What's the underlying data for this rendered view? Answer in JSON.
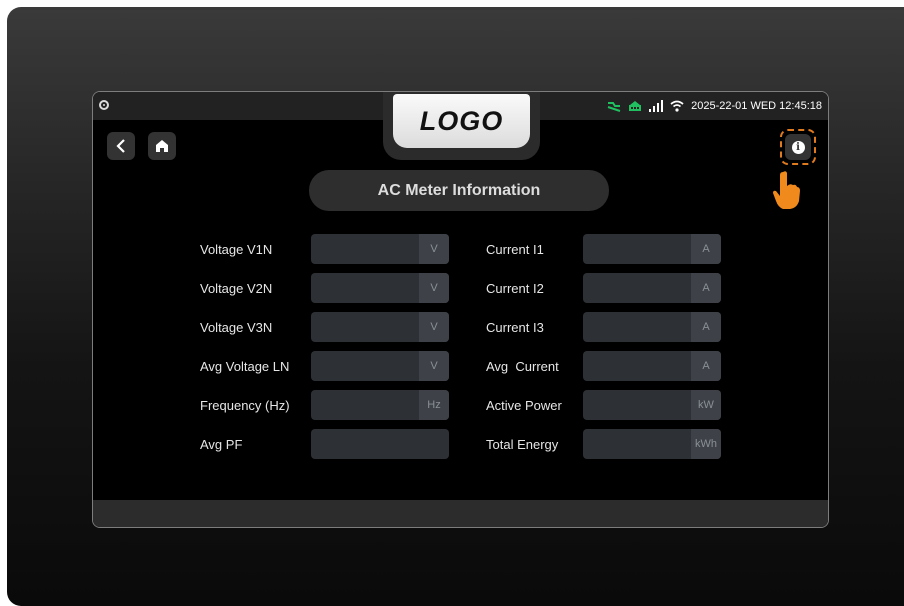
{
  "logo": "LOGO",
  "status": {
    "datetime": "2025-22-01 WED 12:45:18",
    "icons": [
      "charger-icon",
      "network-icon",
      "signal-bars-icon",
      "wifi-icon"
    ]
  },
  "page_title": "AC Meter Information",
  "left_fields": [
    {
      "label": "Voltage V1N",
      "unit": "V"
    },
    {
      "label": "Voltage V2N",
      "unit": "V"
    },
    {
      "label": "Voltage V3N",
      "unit": "V"
    },
    {
      "label": "Avg Voltage LN",
      "unit": "V"
    },
    {
      "label": "Frequency (Hz)",
      "unit": "Hz"
    },
    {
      "label": "Avg PF",
      "unit": ""
    }
  ],
  "right_fields": [
    {
      "label": "Current I1",
      "unit": "A"
    },
    {
      "label": "Current I2",
      "unit": "A"
    },
    {
      "label": "Current I3",
      "unit": "A"
    },
    {
      "label": "Avg  Current",
      "unit": "A"
    },
    {
      "label": "Active Power",
      "unit": "kW"
    },
    {
      "label": "Total Energy",
      "unit": "kWh"
    }
  ],
  "colors": {
    "accent": "#e07a1e",
    "status_green": "#20c060",
    "field_bg": "#2d3035"
  }
}
